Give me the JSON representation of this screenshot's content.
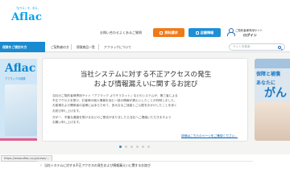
{
  "header": {
    "logo_tagline": "「生きる」を、創る。",
    "logo_word": "Aflac",
    "links": [
      "お問い合わせ",
      "よくあるご質問"
    ],
    "buttons": {
      "estimate": "資料請求",
      "stores": "店舗情報"
    },
    "mypage": {
      "line1": "ご契約者様専用サイト",
      "line2": "ログイン"
    }
  },
  "nav": {
    "items": [
      "保険をご検討の方",
      "ご契約者の方",
      "保険商品一覧",
      "アフラックについて"
    ],
    "search_placeholder": "サイト内検索"
  },
  "left_banner": {
    "word": "Aflac",
    "sub": "アフラックの保険"
  },
  "right_banner": {
    "line1": "保障と補償",
    "line2": "あなたに",
    "line3": "がん"
  },
  "notice_card": {
    "title_line1": "当社システムに対する不正アクセスの発生",
    "title_line2": "および情報漏えいに関するお詫び",
    "body_line1": "当社のご契約者様専用サイト「アフラック よりそうネット」などのシステムが、第三者による",
    "body_line2": "不正アクセスを受け、お客様の個人情報を含む一部の情報が漏えいしたことが判明しました。",
    "body_line3": "お客様および関係者の皆様にはあらためて、多大なるご迷惑とご心配をおかけしたことを深く",
    "body_line4": "お詫び申し上げます。",
    "body_line5": "万が一、不審な連絡を受けるなどのご懸念がありましたら当社へご連絡いただきますよう",
    "body_line6": "お願い申し上げます。",
    "link": "詳細はこちらのページをご確認ください。"
  },
  "carousel": {
    "count": 6,
    "active_index": 0
  },
  "status_url": "https://www.aflac.co.jp/news/...",
  "bottom_notice": "当社システムに対する不正アクセスの発生および情報漏えいに関するお詫び"
}
